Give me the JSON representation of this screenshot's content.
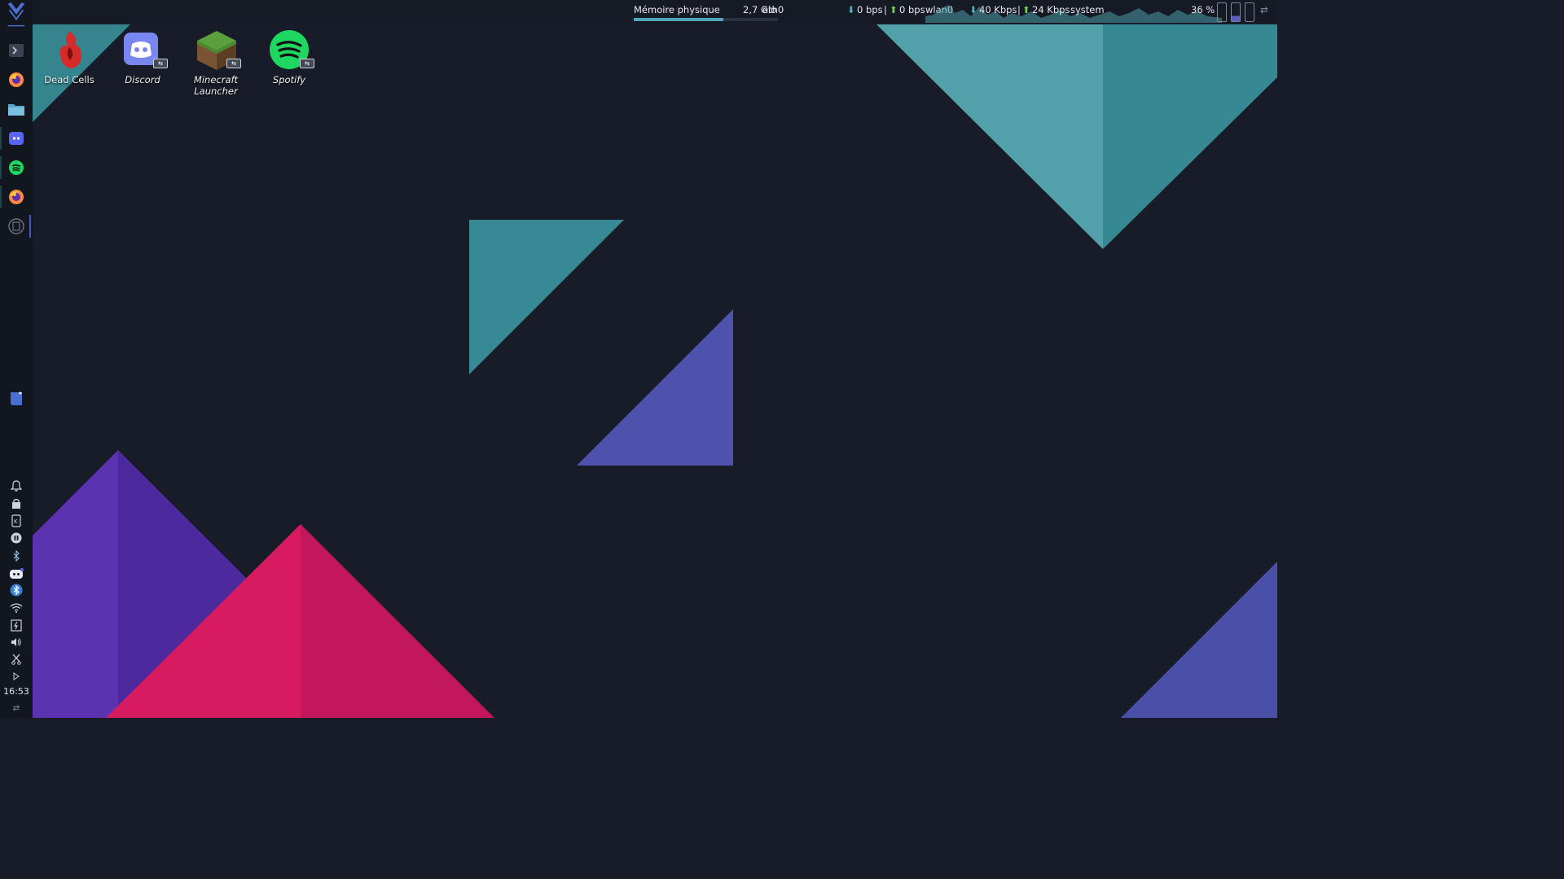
{
  "topbar": {
    "memory_label": "Mémoire physique",
    "memory_value": "2,7  Gio",
    "memory_fraction": 0.62,
    "eth_label": "eth0",
    "eth_down": "0 bps",
    "eth_sep": "|",
    "eth_up": "0 bps",
    "wlan_label": "wlan0",
    "wlan_down": "40 Kbps",
    "wlan_sep": "|",
    "wlan_up": "24 Kbps",
    "system_label": "system",
    "cpu_percent": "36 %"
  },
  "desktop_icons": [
    {
      "name": "dead-cells",
      "label": "Dead Cells",
      "italic": false
    },
    {
      "name": "discord",
      "label": "Discord",
      "italic": true
    },
    {
      "name": "minecraft-launcher",
      "label": "Minecraft Launcher",
      "italic": true
    },
    {
      "name": "spotify",
      "label": "Spotify",
      "italic": true
    }
  ],
  "sidebar": {
    "launcher_icon": "start-menu-icon",
    "items": [
      "terminal-icon",
      "firefox-icon",
      "file-manager-icon",
      "discord-icon",
      "spotify-icon",
      "firefox-icon",
      "pager-icon",
      "notes-icon"
    ],
    "tray": [
      "notifications-icon",
      "vault-icon",
      "kdeconnect-icon",
      "media-pause-icon",
      "bluetooth-small-icon",
      "discord-tray-icon",
      "bluetooth-icon",
      "wifi-icon",
      "battery-icon",
      "volume-icon",
      "scissors-icon",
      "expand-tray-icon"
    ],
    "clock": "16:53"
  },
  "colors": {
    "background": "#181c28",
    "teal": "#4f9ea8",
    "teal_dark": "#35858f",
    "indigo": "#4e52ad",
    "purple": "#5b33b0",
    "crimson": "#d81b60"
  }
}
